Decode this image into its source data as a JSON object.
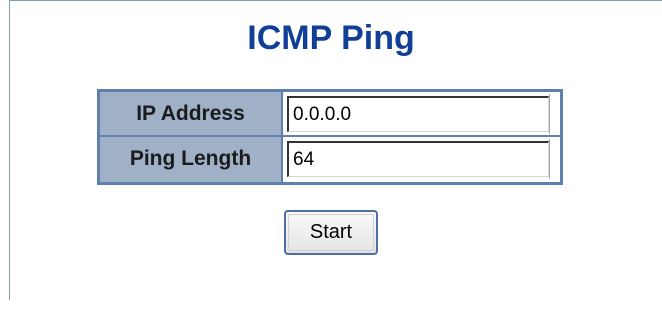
{
  "page": {
    "title": "ICMP Ping"
  },
  "form": {
    "ip_address": {
      "label": "IP Address",
      "value": "0.0.0.0"
    },
    "ping_length": {
      "label": "Ping Length",
      "value": "64"
    }
  },
  "actions": {
    "start_label": "Start"
  },
  "colors": {
    "title": "#113f97",
    "label_background": "#9fb0c7",
    "table_border": "#5f7fae"
  }
}
